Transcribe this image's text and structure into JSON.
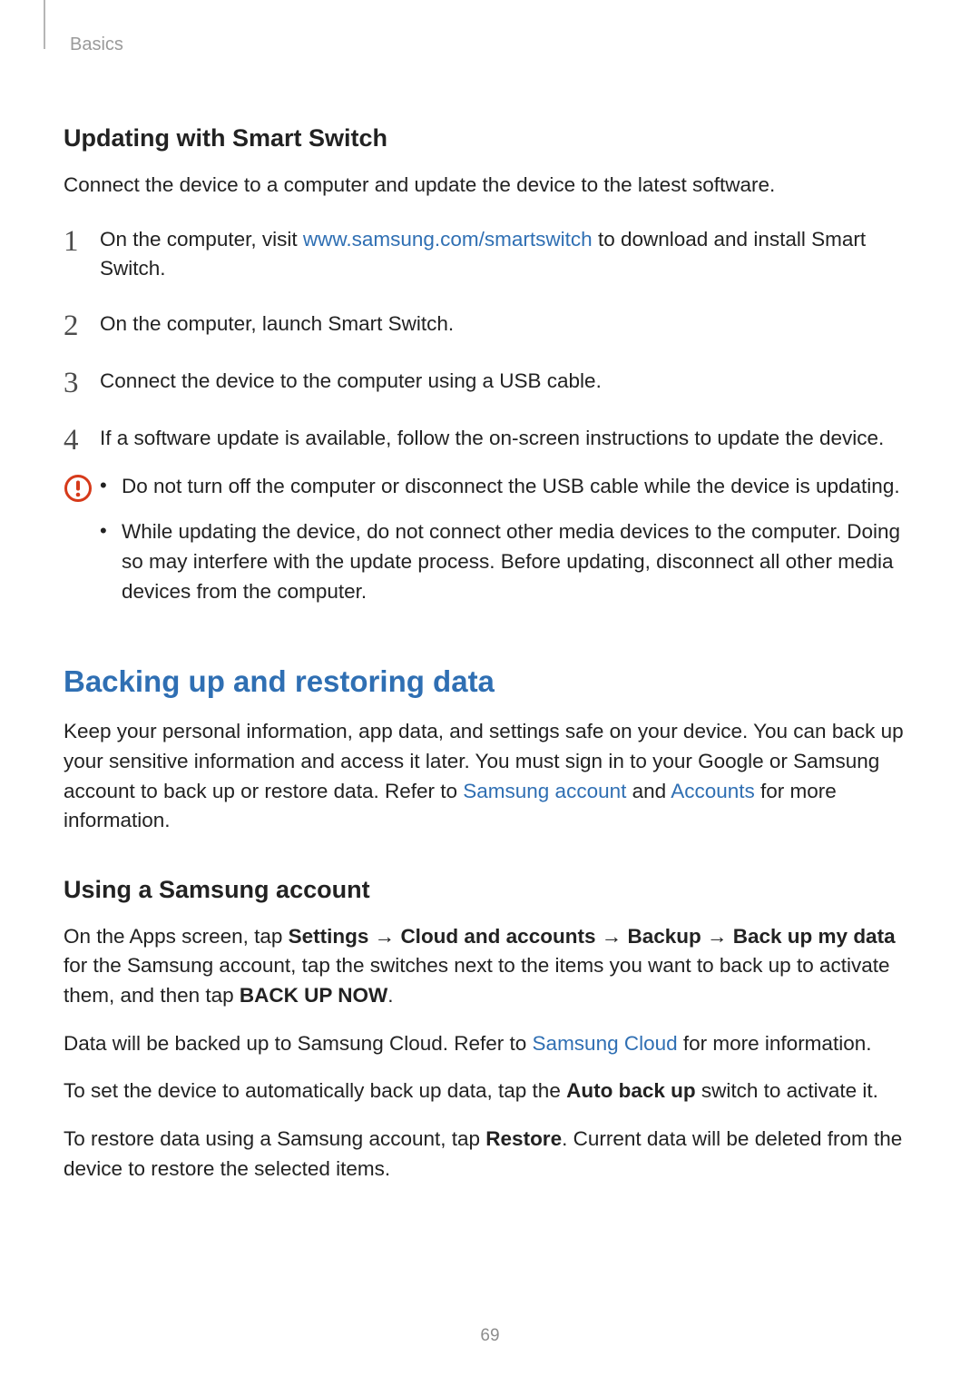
{
  "breadcrumb": "Basics",
  "section1": {
    "heading": "Updating with Smart Switch",
    "intro": "Connect the device to a computer and update the device to the latest software.",
    "step1_num": "1",
    "step1_a": "On the computer, visit ",
    "step1_link": "www.samsung.com/smartswitch",
    "step1_b": " to download and install Smart Switch.",
    "step2_num": "2",
    "step2": "On the computer, launch Smart Switch.",
    "step3_num": "3",
    "step3": "Connect the device to the computer using a USB cable.",
    "step4_num": "4",
    "step4": "If a software update is available, follow the on-screen instructions to update the device.",
    "caution1": "Do not turn off the computer or disconnect the USB cable while the device is updating.",
    "caution2": "While updating the device, do not connect other media devices to the computer. Doing so may interfere with the update process. Before updating, disconnect all other media devices from the computer."
  },
  "section2": {
    "major": "Backing up and restoring data",
    "intro_a": "Keep your personal information, app data, and settings safe on your device. You can back up your sensitive information and access it later. You must sign in to your Google or Samsung account to back up or restore data. Refer to ",
    "intro_link1": "Samsung account",
    "intro_b": " and ",
    "intro_link2": "Accounts",
    "intro_c": " for more information.",
    "sub": "Using a Samsung account",
    "p1_a": "On the Apps screen, tap ",
    "p1_b1": "Settings",
    "p1_arrow1": " → ",
    "p1_b2": "Cloud and accounts",
    "p1_arrow2": " → ",
    "p1_b3": "Backup",
    "p1_arrow3": " → ",
    "p1_b4": "Back up my data",
    "p1_c": " for the Samsung account, tap the switches next to the items you want to back up to activate them, and then tap ",
    "p1_b5": "BACK UP NOW",
    "p1_d": ".",
    "p2_a": "Data will be backed up to Samsung Cloud. Refer to ",
    "p2_link": "Samsung Cloud",
    "p2_b": " for more information.",
    "p3_a": "To set the device to automatically back up data, tap the ",
    "p3_b": "Auto back up",
    "p3_c": " switch to activate it.",
    "p4_a": "To restore data using a Samsung account, tap ",
    "p4_b": "Restore",
    "p4_c": ". Current data will be deleted from the device to restore the selected items."
  },
  "pageNumber": "69"
}
